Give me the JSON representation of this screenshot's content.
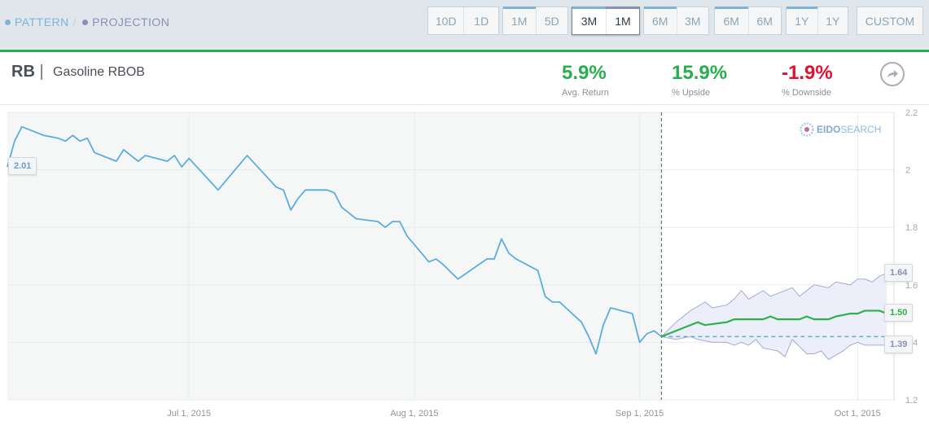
{
  "legend": {
    "pattern": "PATTERN",
    "separator": "/",
    "projection": "PROJECTION",
    "pattern_color": "#7fb3d5",
    "projection_color": "#8a8fb8"
  },
  "range_buttons": [
    {
      "a": "10D",
      "b": "1D",
      "active": false,
      "accent": "#7fb3d5"
    },
    {
      "a": "1M",
      "b": "5D",
      "active": false,
      "accent": "#7fb3d5"
    },
    {
      "a": "3M",
      "b": "1M",
      "active": true,
      "accent": "#7fb3d5"
    },
    {
      "a": "6M",
      "b": "3M",
      "active": false,
      "accent": "#7fb3d5"
    },
    {
      "a": "6M",
      "b": "6M",
      "active": false,
      "accent": "#7fb3d5"
    },
    {
      "a": "1Y",
      "b": "1Y",
      "active": false,
      "accent": "#7fb3d5"
    }
  ],
  "custom_label": "CUSTOM",
  "header": {
    "ticker": "RB",
    "separator": "|",
    "name": "Gasoline RBOB"
  },
  "stats": [
    {
      "value": "5.9%",
      "label": "Avg. Return",
      "color": "#27ae4f"
    },
    {
      "value": "15.9%",
      "label": "% Upside",
      "color": "#27ae4f"
    },
    {
      "value": "-1.9%",
      "label": "% Downside",
      "color": "#e0102f"
    }
  ],
  "logo": {
    "part1": "EIDO",
    "part2": "SEARCH"
  },
  "chart_data": {
    "type": "line",
    "ylim": [
      1.2,
      2.2
    ],
    "y_ticks": [
      "1.2",
      "1.4",
      "1.6",
      "1.8",
      "2",
      "2.2"
    ],
    "x_ticks": [
      {
        "label": "Jul 1, 2015",
        "day": 25
      },
      {
        "label": "Aug 1, 2015",
        "day": 56
      },
      {
        "label": "Sep 1, 2015",
        "day": 87
      },
      {
        "label": "Oct 1, 2015",
        "day": 117
      }
    ],
    "x_range_days": [
      0,
      122
    ],
    "projection_start_day": 90,
    "baseline": 1.42,
    "colors": {
      "pattern": "#5aaedc",
      "projection": "#2fb14a",
      "band_fill": "#eceef9",
      "band_line": "#a7a9d6",
      "baseline": "#5aaedc"
    },
    "labels": [
      {
        "text": "2.01",
        "value": 2.01,
        "color": "#6a9fc8",
        "side": "left"
      },
      {
        "text": "1.64",
        "value": 1.64,
        "color": "#8a8fb8",
        "side": "right"
      },
      {
        "text": "1.50",
        "value": 1.5,
        "color": "#2fb14a",
        "side": "right"
      },
      {
        "text": "1.39",
        "value": 1.39,
        "color": "#8a8fb8",
        "side": "right"
      }
    ],
    "pattern": [
      [
        0,
        2.01
      ],
      [
        1,
        2.1
      ],
      [
        2,
        2.15
      ],
      [
        3,
        2.14
      ],
      [
        4,
        2.13
      ],
      [
        5,
        2.12
      ],
      [
        7,
        2.11
      ],
      [
        8,
        2.1
      ],
      [
        9,
        2.12
      ],
      [
        10,
        2.1
      ],
      [
        11,
        2.11
      ],
      [
        12,
        2.06
      ],
      [
        15,
        2.03
      ],
      [
        16,
        2.07
      ],
      [
        17,
        2.05
      ],
      [
        18,
        2.03
      ],
      [
        19,
        2.05
      ],
      [
        22,
        2.03
      ],
      [
        23,
        2.05
      ],
      [
        24,
        2.01
      ],
      [
        25,
        2.04
      ],
      [
        29,
        1.93
      ],
      [
        30,
        1.96
      ],
      [
        33,
        2.05
      ],
      [
        37,
        1.94
      ],
      [
        38,
        1.93
      ],
      [
        39,
        1.86
      ],
      [
        40,
        1.9
      ],
      [
        41,
        1.93
      ],
      [
        44,
        1.93
      ],
      [
        45,
        1.92
      ],
      [
        46,
        1.87
      ],
      [
        47,
        1.85
      ],
      [
        48,
        1.83
      ],
      [
        51,
        1.82
      ],
      [
        52,
        1.8
      ],
      [
        53,
        1.82
      ],
      [
        54,
        1.82
      ],
      [
        55,
        1.77
      ],
      [
        58,
        1.68
      ],
      [
        59,
        1.69
      ],
      [
        60,
        1.67
      ],
      [
        62,
        1.62
      ],
      [
        66,
        1.69
      ],
      [
        67,
        1.69
      ],
      [
        68,
        1.76
      ],
      [
        69,
        1.71
      ],
      [
        70,
        1.69
      ],
      [
        73,
        1.65
      ],
      [
        74,
        1.56
      ],
      [
        75,
        1.54
      ],
      [
        76,
        1.54
      ],
      [
        79,
        1.47
      ],
      [
        80,
        1.42
      ],
      [
        81,
        1.36
      ],
      [
        82,
        1.46
      ],
      [
        83,
        1.52
      ],
      [
        86,
        1.5
      ],
      [
        87,
        1.4
      ],
      [
        88,
        1.43
      ],
      [
        89,
        1.44
      ],
      [
        90,
        1.42
      ]
    ],
    "projection": [
      [
        90,
        1.42
      ],
      [
        93,
        1.45
      ],
      [
        95,
        1.47
      ],
      [
        96,
        1.46
      ],
      [
        99,
        1.47
      ],
      [
        100,
        1.48
      ],
      [
        101,
        1.48
      ],
      [
        103,
        1.48
      ],
      [
        104,
        1.48
      ],
      [
        105,
        1.49
      ],
      [
        106,
        1.48
      ],
      [
        108,
        1.48
      ],
      [
        109,
        1.48
      ],
      [
        110,
        1.49
      ],
      [
        111,
        1.48
      ],
      [
        113,
        1.48
      ],
      [
        114,
        1.49
      ],
      [
        116,
        1.5
      ],
      [
        117,
        1.5
      ],
      [
        118,
        1.51
      ],
      [
        120,
        1.51
      ],
      [
        121,
        1.5
      ]
    ],
    "band_upper": [
      [
        90,
        1.42
      ],
      [
        92,
        1.47
      ],
      [
        94,
        1.51
      ],
      [
        96,
        1.54
      ],
      [
        97,
        1.52
      ],
      [
        99,
        1.53
      ],
      [
        100,
        1.55
      ],
      [
        101,
        1.58
      ],
      [
        102,
        1.55
      ],
      [
        104,
        1.58
      ],
      [
        105,
        1.56
      ],
      [
        107,
        1.58
      ],
      [
        108,
        1.59
      ],
      [
        109,
        1.56
      ],
      [
        111,
        1.6
      ],
      [
        113,
        1.59
      ],
      [
        114,
        1.61
      ],
      [
        116,
        1.6
      ],
      [
        117,
        1.62
      ],
      [
        118,
        1.62
      ],
      [
        119,
        1.61
      ],
      [
        120,
        1.63
      ],
      [
        121,
        1.64
      ]
    ],
    "band_lower": [
      [
        90,
        1.42
      ],
      [
        92,
        1.41
      ],
      [
        94,
        1.42
      ],
      [
        95,
        1.41
      ],
      [
        97,
        1.4
      ],
      [
        99,
        1.4
      ],
      [
        100,
        1.39
      ],
      [
        101,
        1.4
      ],
      [
        102,
        1.39
      ],
      [
        103,
        1.41
      ],
      [
        104,
        1.38
      ],
      [
        106,
        1.37
      ],
      [
        107,
        1.35
      ],
      [
        108,
        1.41
      ],
      [
        110,
        1.36
      ],
      [
        111,
        1.36
      ],
      [
        112,
        1.37
      ],
      [
        113,
        1.34
      ],
      [
        115,
        1.37
      ],
      [
        116,
        1.39
      ],
      [
        117,
        1.4
      ],
      [
        118,
        1.39
      ],
      [
        119,
        1.39
      ],
      [
        120,
        1.39
      ],
      [
        121,
        1.39
      ]
    ]
  }
}
